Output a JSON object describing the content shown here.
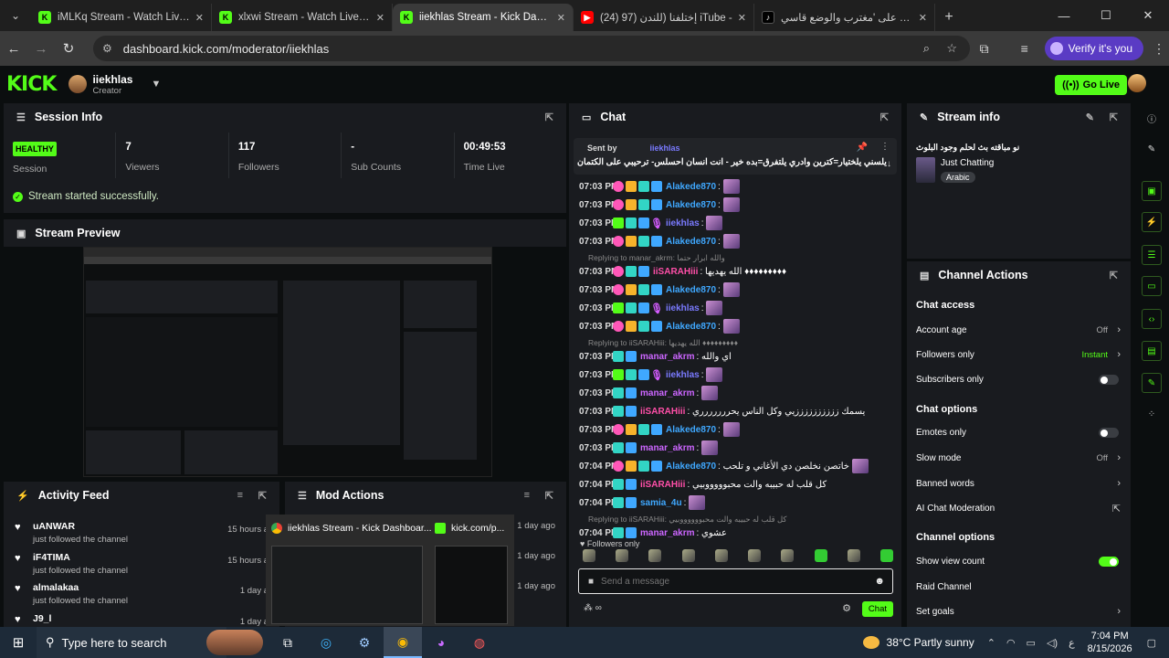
{
  "browser": {
    "tabs": [
      {
        "favicon": "kick",
        "title": "iMLKq Stream - Watch Live on K"
      },
      {
        "favicon": "kick",
        "title": "xlxwi Stream - Watch Live on Ki"
      },
      {
        "favicon": "kick",
        "title": "iiekhlas Stream - Kick Dashboar",
        "active": true
      },
      {
        "favicon": "youtube",
        "title": "(24) إختلفنا (للندن (97 iTube -"
      },
      {
        "favicon": "tiktok",
        "title": "اعثر على 'مغترب والوضع قاسي"
      }
    ],
    "url": "dashboard.kick.com/moderator/iiekhlas",
    "verify_label": "Verify it's you"
  },
  "kick": {
    "logo": "KICK",
    "username": "iiekhlas",
    "role": "Creator",
    "go_live": "Go Live"
  },
  "session": {
    "title": "Session Info",
    "health": "HEALTHY",
    "health_label": "Session",
    "viewers": "7",
    "viewers_label": "Viewers",
    "followers": "117",
    "followers_label": "Followers",
    "subs": "-",
    "subs_label": "Sub Counts",
    "time": "00:49:53",
    "time_label": "Time Live",
    "status": "Stream started successfully."
  },
  "preview": {
    "title": "Stream Preview"
  },
  "activity": {
    "title": "Activity Feed",
    "items": [
      {
        "name": "uANWAR",
        "action": "just followed the channel",
        "time": "15 hours a"
      },
      {
        "name": "iF4TIMA",
        "action": "just followed the channel",
        "time": "15 hours a"
      },
      {
        "name": "almalakaa",
        "action": "just followed the channel",
        "time": "1 day a"
      },
      {
        "name": "J9_l",
        "action": "",
        "time": "1 day a"
      }
    ]
  },
  "mod_actions": {
    "title": "Mod Actions",
    "times": [
      "1 day ago",
      "1 day ago",
      "1 day ago"
    ]
  },
  "taskbar_popup": {
    "window1": "iiekhlas Stream - Kick Dashboar...",
    "window2": "kick.com/p..."
  },
  "chat": {
    "title": "Chat",
    "pinned_sentby": "Sent by",
    "pinned_user": "iiekhlas",
    "pinned_msg": "يلسني يلختيار=كترين وادري يلتفرق=بده خير - انت انسان احسلس- ترحيبي على الكتمان",
    "messages": [
      {
        "time": "07:03 PM",
        "user": "Alakede870",
        "color": "#3fa8ff",
        "text": ":",
        "emote": true,
        "badges": [
          "p",
          "g",
          "c",
          "b"
        ]
      },
      {
        "time": "07:03 PM",
        "user": "Alakede870",
        "color": "#3fa8ff",
        "text": ":",
        "emote": true,
        "badges": [
          "p",
          "g",
          "c",
          "b"
        ]
      },
      {
        "time": "07:03 PM",
        "user": "iiekhlas",
        "color": "#7a7aff",
        "text": ":",
        "emote": true,
        "badges": [
          "s",
          "c",
          "b",
          "m"
        ]
      },
      {
        "time": "07:03 PM",
        "user": "Alakede870",
        "color": "#3fa8ff",
        "text": ":",
        "emote": true,
        "badges": [
          "p",
          "g",
          "c",
          "b"
        ]
      },
      {
        "time": "07:03 PM",
        "user": "iiSARAHiii",
        "color": "#ff4fa8",
        "text": ": الله يهديها ♦♦♦♦♦♦♦♦♦",
        "emote": false,
        "badges": [
          "p",
          "c",
          "b"
        ]
      },
      {
        "time": "07:03 PM",
        "user": "Alakede870",
        "color": "#3fa8ff",
        "text": ":",
        "emote": true,
        "badges": [
          "p",
          "g",
          "c",
          "b"
        ]
      },
      {
        "time": "07:03 PM",
        "user": "iiekhlas",
        "color": "#7a7aff",
        "text": ":",
        "emote": true,
        "badges": [
          "s",
          "c",
          "b",
          "m"
        ]
      },
      {
        "time": "07:03 PM",
        "user": "Alakede870",
        "color": "#3fa8ff",
        "text": ":",
        "emote": true,
        "badges": [
          "p",
          "g",
          "c",
          "b"
        ]
      },
      {
        "time": "07:03 PM",
        "user": "manar_akrm",
        "color": "#cc66ff",
        "text": ": اي والله",
        "emote": false,
        "badges": [
          "c",
          "b"
        ]
      },
      {
        "time": "07:03 PM",
        "user": "iiekhlas",
        "color": "#7a7aff",
        "text": ":",
        "emote": true,
        "badges": [
          "s",
          "c",
          "b",
          "m"
        ]
      },
      {
        "time": "07:03 PM",
        "user": "manar_akrm",
        "color": "#cc66ff",
        "text": ":",
        "emote": true,
        "badges": [
          "c",
          "b"
        ]
      },
      {
        "time": "07:03 PM",
        "user": "iiSARAHiii",
        "color": "#ff4fa8",
        "text": ": يسمك ززززززززززيي وكل الناس يحررررررري",
        "emote": false,
        "badges": [
          "c",
          "b"
        ]
      },
      {
        "time": "07:03 PM",
        "user": "Alakede870",
        "color": "#3fa8ff",
        "text": ":",
        "emote": true,
        "badges": [
          "p",
          "g",
          "c",
          "b"
        ]
      },
      {
        "time": "07:03 PM",
        "user": "manar_akrm",
        "color": "#cc66ff",
        "text": ":",
        "emote": true,
        "badges": [
          "c",
          "b"
        ]
      },
      {
        "time": "07:04 PM",
        "user": "Alakede870",
        "color": "#3fa8ff",
        "text": ": خاتصن نخلصن دي الأغاني و تلحب",
        "emote": true,
        "badges": [
          "p",
          "g",
          "c",
          "b"
        ]
      },
      {
        "time": "07:04 PM",
        "user": "iiSARAHiii",
        "color": "#ff4fa8",
        "text": ": كل قلب له حبيبه والت محبوووووبيي",
        "emote": false,
        "badges": [
          "c",
          "b"
        ]
      },
      {
        "time": "07:04 PM",
        "user": "samia_4u",
        "color": "#3fa8ff",
        "text": ":",
        "emote": true,
        "badges": [
          "c",
          "b"
        ]
      },
      {
        "time": "07:04 PM",
        "user": "manar_akrm",
        "color": "#cc66ff",
        "text": ": عشوي",
        "emote": false,
        "badges": [
          "c",
          "b"
        ]
      }
    ],
    "replies": [
      {
        "before": 4,
        "text": "Replying to manar_akrm: والله ابرار حتما"
      },
      {
        "before": 8,
        "text": "Replying to iiSARAHiii: الله يهديها ♦♦♦♦♦♦♦♦♦"
      },
      {
        "before": 17,
        "text": "Replying to iiSARAHiii: كل قلب له حبيبه والت محبووووووبيي"
      }
    ],
    "followers_only": "Followers only",
    "input_placeholder": "Send a message",
    "send_label": "Chat"
  },
  "stream_info": {
    "title": "Stream info",
    "stream_title": "نو مباقته بث لحلم وجود البلوث",
    "category": "Just Chatting",
    "tag": "Arabic"
  },
  "channel_actions": {
    "title": "Channel Actions",
    "chat_access": "Chat access",
    "account_age": "Account age",
    "account_age_val": "Off",
    "followers_only": "Followers only",
    "followers_only_val": "Instant",
    "subscribers_only": "Subscribers only",
    "chat_options": "Chat options",
    "emotes_only": "Emotes only",
    "slow_mode": "Slow mode",
    "slow_mode_val": "Off",
    "banned_words": "Banned words",
    "ai_moderation": "AI Chat Moderation",
    "channel_options": "Channel options",
    "show_view_count": "Show view count",
    "raid_channel": "Raid Channel",
    "set_goals": "Set goals"
  },
  "taskbar": {
    "search": "Type here to search",
    "weather": "38°C  Partly sunny",
    "lang": "ع",
    "time": "7:04 PM",
    "date": "8/15/2026"
  }
}
